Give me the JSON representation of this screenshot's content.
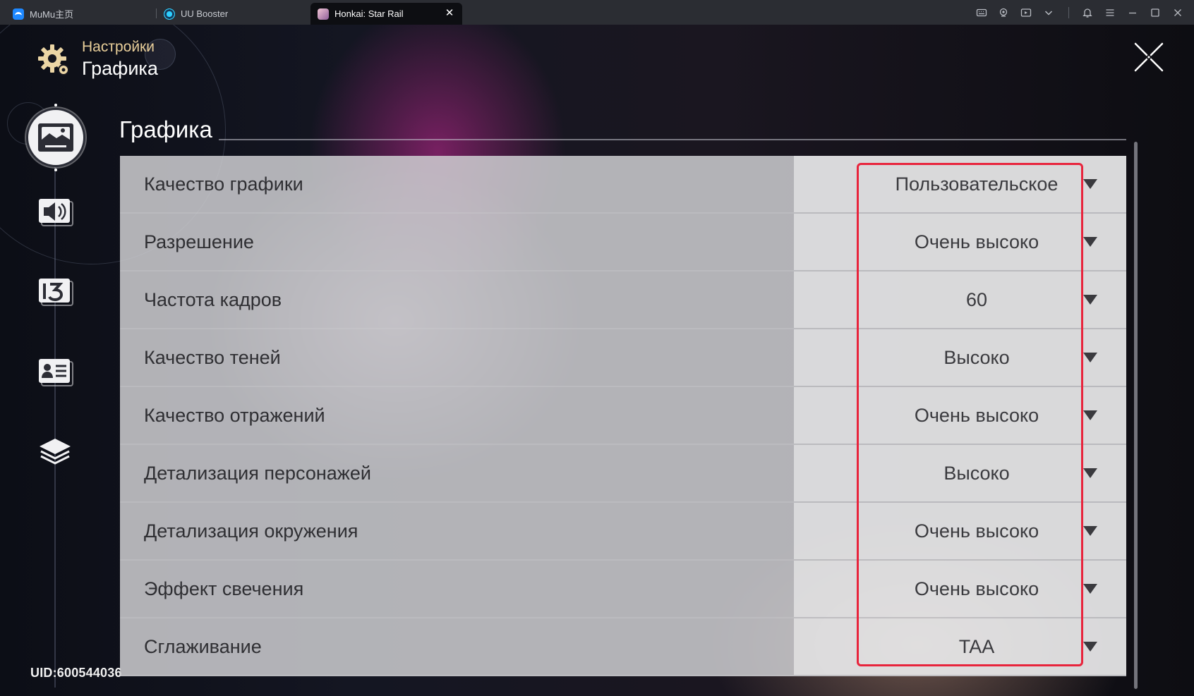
{
  "tabs": [
    {
      "label": "MuMu主页",
      "icon": "mumu-logo-icon"
    },
    {
      "label": "UU Booster",
      "icon": "uu-booster-icon"
    },
    {
      "label": "Honkai: Star Rail",
      "icon": "star-rail-icon",
      "active": true
    }
  ],
  "header": {
    "pretitle": "Настройки",
    "title": "Графика"
  },
  "sidebar": {
    "items": [
      {
        "name": "graphics",
        "icon": "image-icon",
        "active": true
      },
      {
        "name": "audio",
        "icon": "speaker-icon"
      },
      {
        "name": "language",
        "icon": "language-icon"
      },
      {
        "name": "account",
        "icon": "profile-card-icon"
      },
      {
        "name": "other",
        "icon": "layers-icon"
      }
    ],
    "uid": "UID:600544036"
  },
  "section": {
    "title": "Графика"
  },
  "settings": [
    {
      "label": "Качество графики",
      "value": "Пользовательское"
    },
    {
      "label": "Разрешение",
      "value": "Очень высоко"
    },
    {
      "label": "Частота кадров",
      "value": "60"
    },
    {
      "label": "Качество теней",
      "value": "Высоко"
    },
    {
      "label": "Качество отражений",
      "value": "Очень высоко"
    },
    {
      "label": "Детализация персонажей",
      "value": "Высоко"
    },
    {
      "label": "Детализация окружения",
      "value": "Очень высоко"
    },
    {
      "label": "Эффект свечения",
      "value": "Очень высоко"
    },
    {
      "label": "Сглаживание",
      "value": "TAA"
    }
  ],
  "colors": {
    "highlight": "#e8243c",
    "header_accent": "#e9cf9a"
  }
}
